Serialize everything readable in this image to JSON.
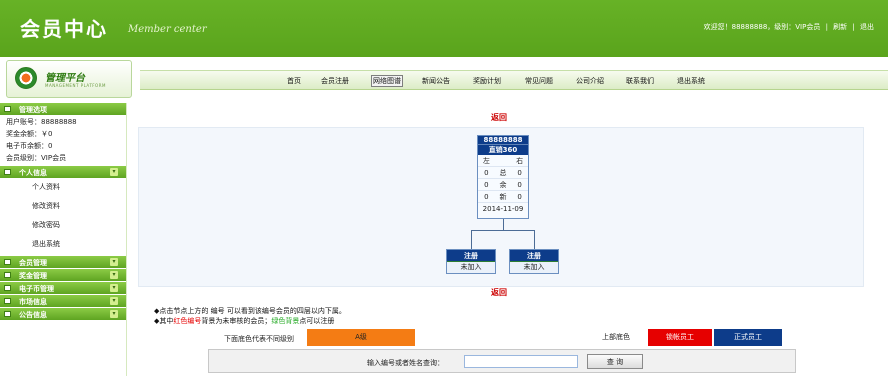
{
  "header": {
    "title": "会员中心",
    "subtitle": "Member center",
    "welcome": "欢迎您！88888888，级别：VIP会员",
    "refresh": "刷新",
    "logout": "退出"
  },
  "logo": {
    "text": "管理平台",
    "small": "MANAGEMENT PLATFORM"
  },
  "nav": {
    "items": [
      "首页",
      "会员注册",
      "网络图谱",
      "新闻公告",
      "奖励计划",
      "常见问题",
      "公司介绍",
      "联系我们",
      "退出系统"
    ],
    "active": "网络图谱"
  },
  "sidebar": {
    "manage_title": "管理选项",
    "account": "用户账号：88888888",
    "bonus": "奖金余额：￥0",
    "ecoin": "电子币余额：0",
    "level": "会员级别：VIP会员",
    "personal_title": "个人信息",
    "personal_items": [
      "个人资料",
      "修改资料",
      "修改密码",
      "退出系统"
    ],
    "sections": [
      "会员管理",
      "奖金管理",
      "电子币管理",
      "市场信息",
      "公告信息"
    ],
    "expand_icon": "chevron-down-icon"
  },
  "tree": {
    "return_label": "返回",
    "root": {
      "id": "88888888",
      "name": "直销360",
      "col_left": "左",
      "col_right": "右",
      "rows": [
        [
          "0",
          "总",
          "0"
        ],
        [
          "0",
          "余",
          "0"
        ],
        [
          "0",
          "新",
          "0"
        ]
      ],
      "date": "2014-11-09"
    },
    "children": [
      {
        "head": "注册",
        "body": "未加入"
      },
      {
        "head": "注册",
        "body": "未加入"
      }
    ]
  },
  "notes": {
    "line1": "◆点击节点上方的 编号 可以看到该编号会员的四层以内下属。",
    "line2_prefix": "◆其中",
    "line2_red": "红色编号",
    "line2_mid": "背景为未审核的会员；",
    "line2_green": "绿色背景",
    "line2_suffix": "点可以注册"
  },
  "legend": {
    "label": "下面底色代表不同级别",
    "items": [
      {
        "text": "A级",
        "color": "#f47c14"
      },
      {
        "text": "上部底色",
        "color": "#ffffff"
      },
      {
        "text": "锁帐员工",
        "color": "#e60000"
      },
      {
        "text": "正式员工",
        "color": "#0d3c8a"
      }
    ]
  },
  "search": {
    "label": "输入编号或者姓名查询：",
    "value": "",
    "button": "查 询"
  },
  "colors": {
    "brand": "#5aa41c",
    "node_head": "#0d3c8a",
    "return_red": "#cc0000"
  }
}
